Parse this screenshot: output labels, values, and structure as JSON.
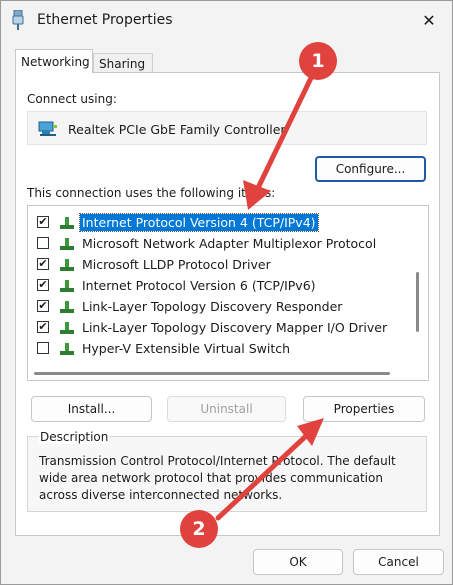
{
  "window": {
    "title": "Ethernet Properties",
    "close_glyph": "✕"
  },
  "tabs": [
    {
      "label": "Networking",
      "active": true
    },
    {
      "label": "Sharing",
      "active": false
    }
  ],
  "connect": {
    "label": "Connect using:",
    "adapter": "Realtek PCIe GbE Family Controller",
    "configure_button": "Configure..."
  },
  "components": {
    "label": "This connection uses the following items:",
    "items": [
      {
        "label": "Internet Protocol Version 4 (TCP/IPv4)",
        "checked": true,
        "selected": true
      },
      {
        "label": "Microsoft Network Adapter Multiplexor Protocol",
        "checked": false,
        "selected": false
      },
      {
        "label": "Microsoft LLDP Protocol Driver",
        "checked": true,
        "selected": false
      },
      {
        "label": "Internet Protocol Version 6 (TCP/IPv6)",
        "checked": true,
        "selected": false
      },
      {
        "label": "Link-Layer Topology Discovery Responder",
        "checked": true,
        "selected": false
      },
      {
        "label": "Link-Layer Topology Discovery Mapper I/O Driver",
        "checked": true,
        "selected": false
      },
      {
        "label": "Hyper-V Extensible Virtual Switch",
        "checked": false,
        "selected": false
      }
    ]
  },
  "buttons": {
    "install": "Install...",
    "uninstall": "Uninstall",
    "properties": "Properties",
    "ok": "OK",
    "cancel": "Cancel"
  },
  "description": {
    "title": "Description",
    "text": "Transmission Control Protocol/Internet Protocol. The default wide area network protocol that provides communication across diverse interconnected networks."
  },
  "annotations": {
    "badge1": "1",
    "badge2": "2",
    "color": "#e0433e"
  }
}
